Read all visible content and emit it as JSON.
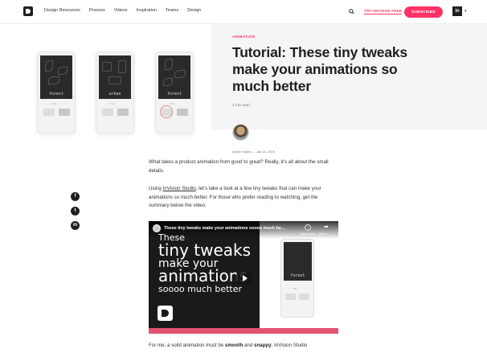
{
  "nav": {
    "links": [
      "Design Resources",
      "Process",
      "Videos",
      "Inspiration",
      "Teams",
      "Design"
    ],
    "try_label": "TRY INVISION FREE",
    "subscribe_label": "SUBSCRIBE",
    "in_label": "in",
    "chevron": "▾"
  },
  "hero": {
    "category": "ANIMATION",
    "title": "Tutorial: These tiny tweaks make your animations so much better",
    "read_time": "3 min read",
    "phones": [
      {
        "label": "forest"
      },
      {
        "label": "urban"
      },
      {
        "label": "forest"
      }
    ]
  },
  "author": {
    "byline": "Austin Saylor — Jan 24, 2019"
  },
  "article": {
    "p1": "What takes a product animation from good to great? Really, it’s all about the small details.",
    "p2_pre": "Using ",
    "p2_link": "InVision Studio",
    "p2_post": ", let’s take a look at a few tiny tweaks that can make your animations so much better. For those who prefer reading to watching, get the summary below the video.",
    "p3_pre": "For me, a solid animation must be ",
    "p3_b1": "smooth",
    "p3_mid": " and ",
    "p3_b2": "snappy",
    "p3_post": ". InVision Studio"
  },
  "share": {
    "facebook": "f",
    "twitter": "t",
    "messenger": "m"
  },
  "video": {
    "title": "These tiny tweaks make your animations soooo much be...",
    "watch_later": "Watch later",
    "share": "Share",
    "lines": [
      "These",
      "tiny tweaks",
      "make your",
      "animations",
      "soooo much better"
    ],
    "phone_label": "forest"
  },
  "colors": {
    "accent": "#ff3366",
    "video_bar": "#e2536f"
  }
}
